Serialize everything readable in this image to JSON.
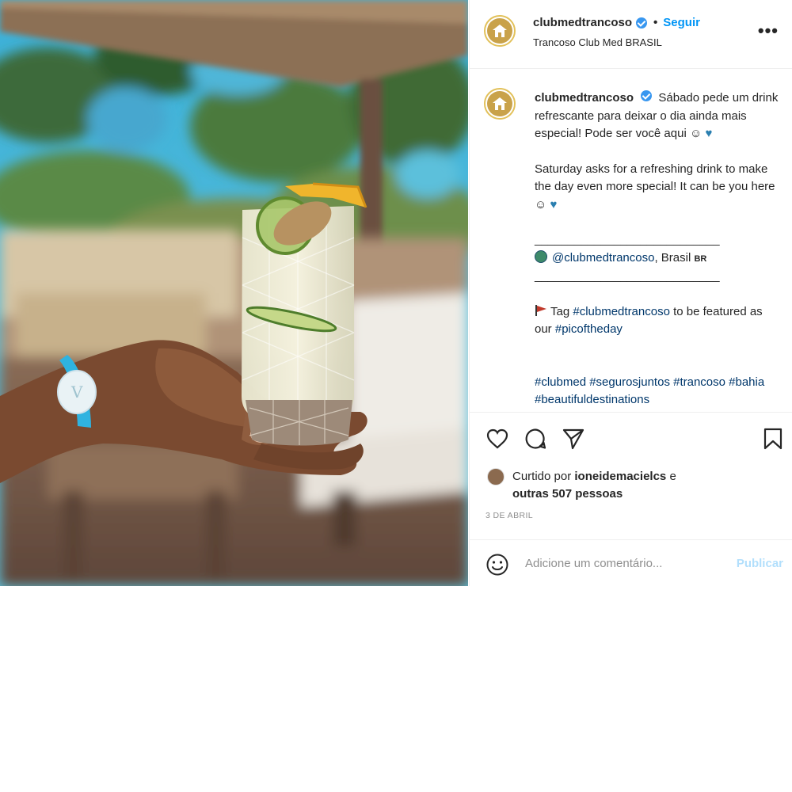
{
  "post": {
    "username": "clubmedtrancoso",
    "follow_label": "Seguir",
    "location": "Trancoso Club Med BRASIL",
    "more_label": "•••",
    "photo_alt": "cocktail-photo"
  },
  "caption": {
    "username": "clubmedtrancoso",
    "line1_pt": "Sábado pede um drink refrescante para deixar o dia ainda mais especial! Pode ser você aqui ☺",
    "heart": "💙",
    "line1_en": "Saturday asks for a refreshing drink to make the day even more special! It can be you here ☺",
    "separator": "____________________________",
    "mention": "@clubmedtrancoso",
    "mention_suffix": ", Brasil",
    "country_code": "BR",
    "tag_prefix": "Tag ",
    "tag_hashtag": "#clubmedtrancoso",
    "tag_middle": " to be featured as our ",
    "tag_featured": "#picoftheday",
    "hashtags": "#clubmed #segurosjuntos #trancoso #bahia #beautifuldestinations"
  },
  "actions": {
    "liked_by_prefix": "Curtido por ",
    "liked_by_user": "ioneidemacielcs",
    "liked_by_connector": " e",
    "others": "outras 507 pessoas",
    "date": "3 DE ABRIL"
  },
  "comment": {
    "placeholder": "Adicione um comentário...",
    "publish_label": "Publicar"
  },
  "colors": {
    "accent": "#0095f6",
    "publish_disabled": "#b2dffc",
    "hashtag": "#00376b",
    "verified": "#3897f0"
  },
  "icons": {
    "like": "heart-icon",
    "comment": "comment-icon",
    "share": "paper-plane-icon",
    "save": "bookmark-icon",
    "emoji": "smiley-icon",
    "more": "more-options-icon",
    "verified": "verified-badge-icon"
  }
}
